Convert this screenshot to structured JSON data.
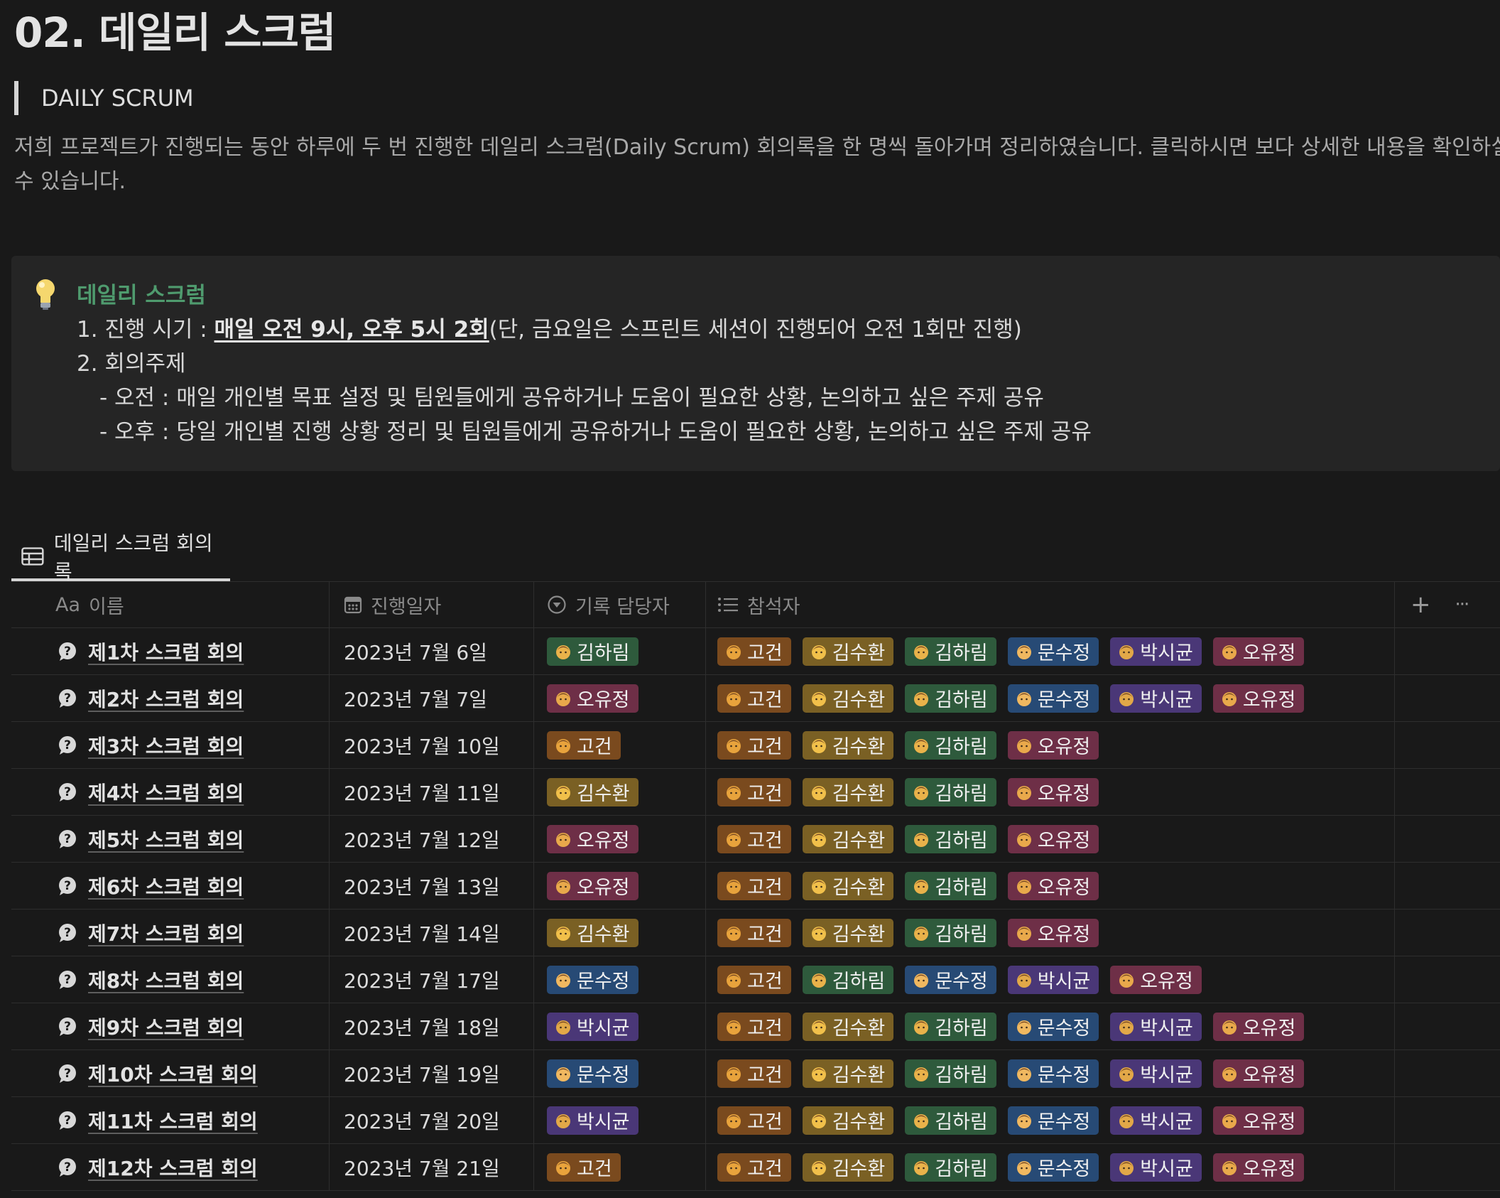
{
  "page": {
    "title": "02. 데일리 스크럼",
    "quote": "DAILY SCRUM",
    "intro_line1": "저희 프로젝트가 진행되는 동안 하루에 두 번 진행한 데일리 스크럼(Daily Scrum) 회의록을 한 명씩 돌아가며 정리하였습니다. 클릭하시면 보다 상세한 내용을 확인하실",
    "intro_line2": "수 있습니다."
  },
  "callout": {
    "icon": "lightbulb-icon",
    "title": "데일리 스크럼",
    "line1_prefix": "1. 진행 시기 : ",
    "line1_highlight": "매일 오전 9시, 오후 5시 2회",
    "line1_suffix": "(단, 금요일은 스프린트 세션이 진행되어 오전 1회만 진행)",
    "line2": "2. 회의주제",
    "line3": "- 오전 : 매일 개인별 목표 설정 및 팀원들에게 공유하거나 도움이 필요한 상황, 논의하고 싶은 주제 공유",
    "line4": "- 오후 : 당일 개인별 진행 상황 정리 및 팀원들에게 공유하거나 도움이 필요한 상황, 논의하고 싶은 주제 공유"
  },
  "database": {
    "view_tab": "데일리 스크럼 회의록",
    "columns": {
      "name": "이름",
      "name_icon": "Aa",
      "date": "진행일자",
      "recorder": "기록 담당자",
      "attendees": "참석자",
      "add": "+",
      "more": "···"
    },
    "person_colors": {
      "고건": "#7a4a1e",
      "김수환": "#7a6024",
      "김하림": "#2e5a3c",
      "문수정": "#274a75",
      "박시균": "#4a3777",
      "오유정": "#6e2f47"
    },
    "rows": [
      {
        "name": "제1차 스크럼 회의",
        "date": "2023년 7월 6일",
        "recorder": "김하림",
        "attendees": [
          "고건",
          "김수환",
          "김하림",
          "문수정",
          "박시균",
          "오유정"
        ]
      },
      {
        "name": "제2차 스크럼 회의",
        "date": "2023년 7월 7일",
        "recorder": "오유정",
        "attendees": [
          "고건",
          "김수환",
          "김하림",
          "문수정",
          "박시균",
          "오유정"
        ]
      },
      {
        "name": "제3차 스크럼 회의",
        "date": "2023년 7월 10일",
        "recorder": "고건",
        "attendees": [
          "고건",
          "김수환",
          "김하림",
          "오유정"
        ]
      },
      {
        "name": "제4차 스크럼 회의",
        "date": "2023년 7월 11일",
        "recorder": "김수환",
        "attendees": [
          "고건",
          "김수환",
          "김하림",
          "오유정"
        ]
      },
      {
        "name": "제5차 스크럼 회의",
        "date": "2023년 7월 12일",
        "recorder": "오유정",
        "attendees": [
          "고건",
          "김수환",
          "김하림",
          "오유정"
        ]
      },
      {
        "name": "제6차 스크럼 회의",
        "date": "2023년 7월 13일",
        "recorder": "오유정",
        "attendees": [
          "고건",
          "김수환",
          "김하림",
          "오유정"
        ]
      },
      {
        "name": "제7차 스크럼 회의",
        "date": "2023년 7월 14일",
        "recorder": "김수환",
        "attendees": [
          "고건",
          "김수환",
          "김하림",
          "오유정"
        ]
      },
      {
        "name": "제8차 스크럼 회의",
        "date": "2023년 7월 17일",
        "recorder": "문수정",
        "attendees": [
          "고건",
          "김하림",
          "문수정",
          "박시균",
          "오유정"
        ]
      },
      {
        "name": "제9차 스크럼 회의",
        "date": "2023년 7월 18일",
        "recorder": "박시균",
        "attendees": [
          "고건",
          "김수환",
          "김하림",
          "문수정",
          "박시균",
          "오유정"
        ]
      },
      {
        "name": "제10차 스크럼 회의",
        "date": "2023년 7월 19일",
        "recorder": "문수정",
        "attendees": [
          "고건",
          "김수환",
          "김하림",
          "문수정",
          "박시균",
          "오유정"
        ]
      },
      {
        "name": "제11차 스크럼 회의",
        "date": "2023년 7월 20일",
        "recorder": "박시균",
        "attendees": [
          "고건",
          "김수환",
          "김하림",
          "문수정",
          "박시균",
          "오유정"
        ]
      },
      {
        "name": "제12차 스크럼 회의",
        "date": "2023년 7월 21일",
        "recorder": "고건",
        "attendees": [
          "고건",
          "김수환",
          "김하림",
          "문수정",
          "박시균",
          "오유정"
        ]
      }
    ]
  }
}
